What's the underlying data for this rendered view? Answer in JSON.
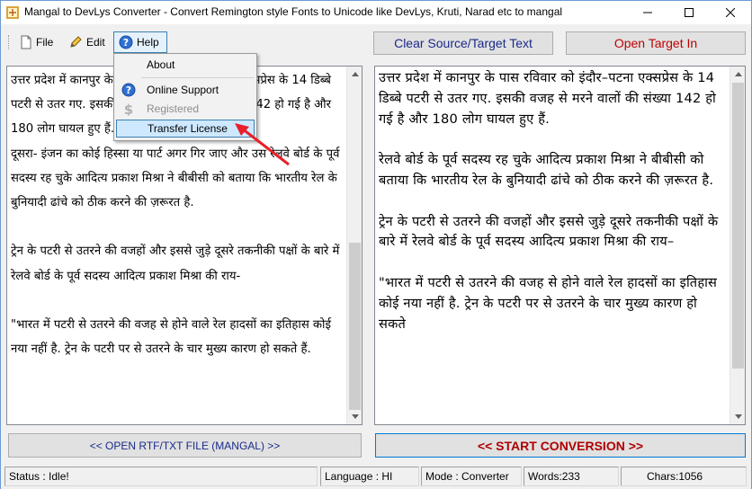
{
  "window": {
    "title": "Mangal to DevLys Converter - Convert Remington style Fonts to Unicode like DevLys, Kruti, Narad etc to mangal"
  },
  "menu": {
    "file": "File",
    "edit": "Edit",
    "help": "Help"
  },
  "help_menu": {
    "items": [
      {
        "label": "About",
        "icon": "none"
      },
      {
        "label": "Online Support",
        "icon": "question-icon"
      },
      {
        "label": "Registered",
        "icon": "dollar-icon",
        "disabled": true
      },
      {
        "label": "Transfer License",
        "icon": "none",
        "highlighted": true
      }
    ]
  },
  "buttons": {
    "clear": "Clear Source/Target Text",
    "open_target": "Open Target In",
    "open_file": "<< OPEN RTF/TXT FILE (MANGAL) >>",
    "start": "<< START CONVERSION >>"
  },
  "source": {
    "text": "उत्तर प्रदेश में कानपुर के पास रविवार को इंदौर–पटना एक्सप्रेस के 14 डिब्बे पटरी से उतर गए. इसकी वजह से मरने वालों की संख्या 142 हो गई है और 180 लोग घायल हुए हैं.\nदूसरा- इंजन का कोई हिस्सा या पार्ट अगर गिर जाए और उस रेलवे बोर्ड के पूर्व सदस्य रह चुके आदित्य प्रकाश मिश्रा ने बीबीसी को बताया कि भारतीय रेल के बुनियादी ढांचे को ठीक करने की ज़रूरत है.\n\nट्रेन के पटरी से उतरने की वजहों और इससे जुड़े दूसरे तकनीकी पक्षों के बारे में रेलवे बोर्ड के पूर्व सदस्य आदित्य प्रकाश मिश्रा की राय-\n\n\"भारत में पटरी से उतरने की वजह से होने वाले रेल हादसों का इतिहास कोई नया नहीं है. ट्रेन के पटरी पर से उतरने के चार मुख्य कारण हो सकते हैं."
  },
  "target": {
    "text": "उत्तर प्रदेश में कानपुर के पास रविवार को इंदौर–पटना एक्सप्रेस के 14 डिब्बे पटरी से उतर गए. इसकी वजह से मरने वालों की संख्या 142 हो गई है और 180 लोग घायल हुए हैं.\n\nरेलवे बोर्ड के पूर्व सदस्य रह चुके आदित्य प्रकाश मिश्रा ने बीबीसी को बताया कि भारतीय रेल के बुनियादी ढांचे को ठीक करने की ज़रूरत है.\n\nट्रेन के पटरी से उतरने की वजहों और इससे जुड़े दूसरे तकनीकी पक्षों के बारे में रेलवे बोर्ड के पूर्व सदस्य आदित्य प्रकाश मिश्रा की राय–\n\n\"भारत में पटरी से उतरने की वजह से होने वाले रेल हादसों का इतिहास कोई नया नहीं है. ट्रेन के पटरी पर से उतरने के चार मुख्य कारण हो सकते"
  },
  "status": {
    "status": "Status :   Idle!",
    "language": "Language : HI",
    "mode": "Mode : Converter",
    "words": "Words:233",
    "chars": "Chars:1056"
  },
  "colors": {
    "accent_blue": "#0078d7",
    "clear_text": "#1a2a8a",
    "target_red": "#c00000",
    "highlight": "#cde8ff",
    "arrow": "#e8202a"
  }
}
